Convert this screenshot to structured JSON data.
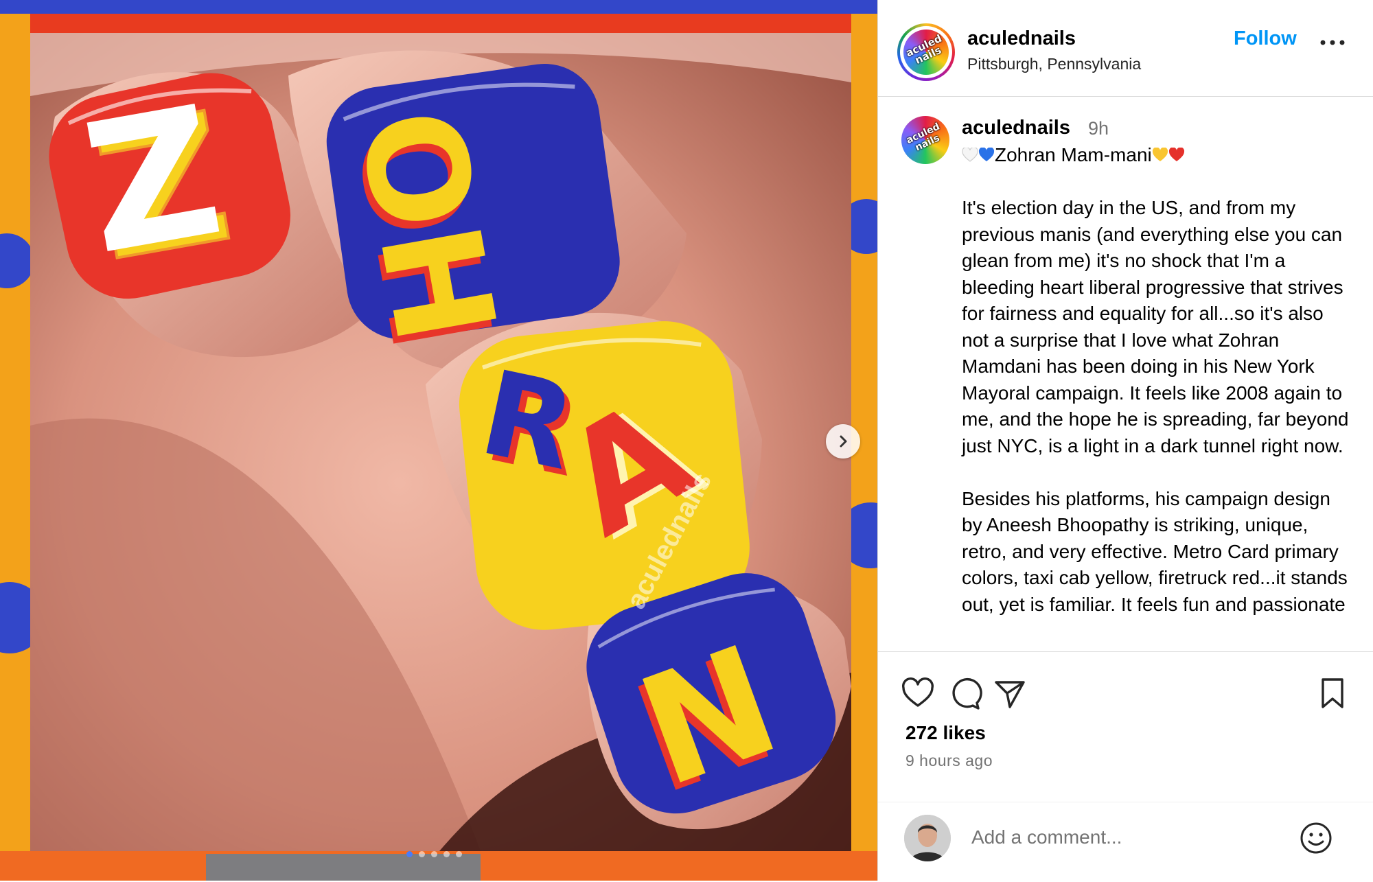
{
  "post": {
    "image_alt": "",
    "watermark": "aculednails",
    "nail_letters": [
      "Z",
      "OH",
      "RA",
      "N"
    ],
    "carousel": {
      "count": 5,
      "active_index": 0
    }
  },
  "header": {
    "username": "aculednails",
    "location": "Pittsburgh, Pennsylvania",
    "follow_label": "Follow",
    "avatar_text": "aculed nails"
  },
  "caption": {
    "username": "aculednails",
    "time": "9h",
    "first_line_emojis": [
      "white-heart",
      "blue-heart"
    ],
    "first_line": "Zohran Mam-mani",
    "end_emojis": [
      "yellow-heart",
      "red-heart"
    ],
    "body": "It's election day in the US, and from my previous manis (and everything else you can glean from me) it's no shock that I'm a bleeding heart liberal progressive that strives for fairness and equality for all...so it's also not a surprise that I love what Zohran Mamdani has been doing in his New York Mayoral campaign. It feels like 2008 again to me, and the hope he is spreading, far beyond just NYC, is a light in a dark tunnel right now.\n\nBesides his platforms, his campaign design by Aneesh Bhoopathy is striking, unique, retro, and very effective. Metro Card primary colors, taxi cab yellow, firetruck red...it stands out, yet is familiar. It feels fun and passionate"
  },
  "actions": {
    "likes": "272 likes",
    "time_ago": "9 hours ago"
  },
  "comment": {
    "placeholder": "Add a comment..."
  },
  "colors": {
    "brand_blue": "#0095f6",
    "nail_red": "#e8352a",
    "nail_blue": "#2a2fb0",
    "nail_yellow": "#f7d11e"
  }
}
